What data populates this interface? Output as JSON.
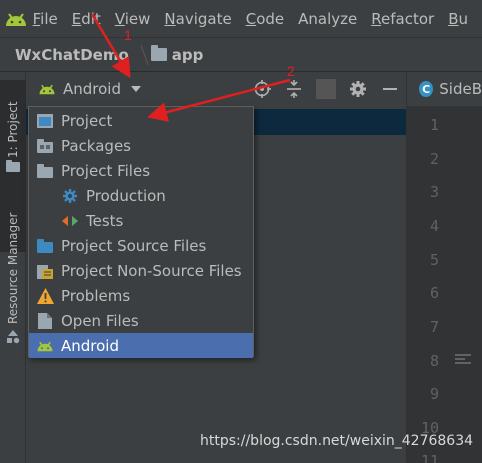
{
  "menubar": {
    "items": [
      {
        "label": "File",
        "u": "F",
        "rest": "ile"
      },
      {
        "label": "Edit",
        "u": "E",
        "rest": "dit"
      },
      {
        "label": "View",
        "u": "V",
        "rest": "iew"
      },
      {
        "label": "Navigate",
        "u": "N",
        "rest": "avigate"
      },
      {
        "label": "Code",
        "u": "C",
        "rest": "ode"
      },
      {
        "label": "Analyze",
        "u": "",
        "rest": "Analyze"
      },
      {
        "label": "Refactor",
        "u": "R",
        "rest": "efactor"
      },
      {
        "label": "Bu",
        "u": "B",
        "rest": "u"
      }
    ]
  },
  "breadcrumb": {
    "project": "WxChatDemo",
    "module": "app"
  },
  "annotations": {
    "one": "1",
    "two": "2"
  },
  "stripe": {
    "project_tab": "1: Project",
    "resource_tab": "Resource Manager"
  },
  "project_panel": {
    "view_selector": "Android"
  },
  "editor": {
    "tab": "SideB",
    "line_numbers": [
      "1",
      "2",
      "3",
      "4",
      "5",
      "6",
      "7",
      "8",
      "9",
      "10",
      "11"
    ]
  },
  "dropdown": {
    "options": [
      {
        "label": "Project",
        "icon": "project-icon"
      },
      {
        "label": "Packages",
        "icon": "packages-icon"
      },
      {
        "label": "Project Files",
        "icon": "folder-icon"
      },
      {
        "label": "Production",
        "icon": "production-gear-icon"
      },
      {
        "label": "Tests",
        "icon": "tests-icon"
      },
      {
        "label": "Project Source Files",
        "icon": "source-folder-icon"
      },
      {
        "label": "Project Non-Source Files",
        "icon": "non-source-icon"
      },
      {
        "label": "Problems",
        "icon": "warning-icon"
      },
      {
        "label": "Open Files",
        "icon": "file-icon"
      },
      {
        "label": "Android",
        "icon": "android-icon"
      }
    ],
    "selected": "Android"
  },
  "colors": {
    "selection": "#4b6eaf",
    "android_green": "#a4c639",
    "annotation_red": "#e02020",
    "folder_blue": "#3d8ac2"
  },
  "watermark": "https://blog.csdn.net/weixin_42768634"
}
